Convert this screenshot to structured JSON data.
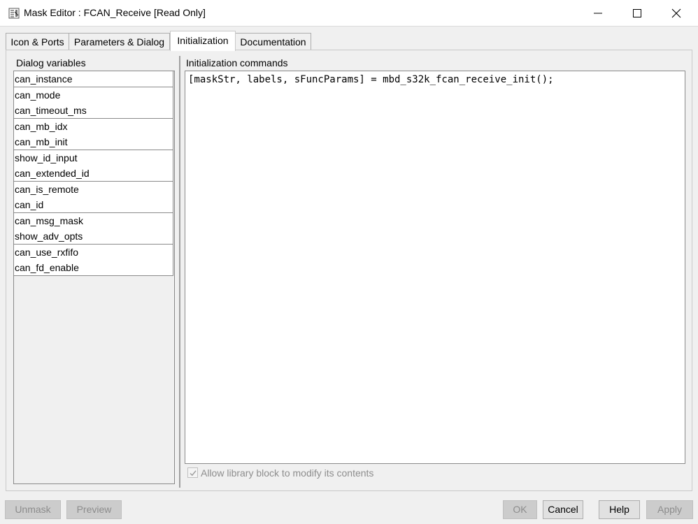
{
  "window": {
    "title": "Mask Editor : FCAN_Receive [Read Only]",
    "app_icon": "mask-editor-icon",
    "controls": [
      "minimize-icon",
      "maximize-icon",
      "close-icon"
    ]
  },
  "tabs": [
    {
      "label": "Icon & Ports",
      "active": false
    },
    {
      "label": "Parameters & Dialog",
      "active": false
    },
    {
      "label": "Initialization",
      "active": true
    },
    {
      "label": "Documentation",
      "active": false
    }
  ],
  "dialog_variables": {
    "header": "Dialog variables",
    "items": [
      "can_instance",
      "can_mode",
      "can_timeout_ms",
      "can_mb_idx",
      "can_mb_init",
      "show_id_input",
      "can_extended_id",
      "can_is_remote",
      "can_id",
      "can_msg_mask",
      "show_adv_opts",
      "can_use_rxfifo",
      "can_fd_enable"
    ]
  },
  "initialization": {
    "header": "Initialization commands",
    "code": "[maskStr, labels, sFuncParams] = mbd_s32k_fcan_receive_init();"
  },
  "allow_modify": {
    "label": "Allow library block to modify its contents",
    "checked": true,
    "enabled": false
  },
  "buttons": {
    "unmask": "Unmask",
    "preview": "Preview",
    "ok": "OK",
    "cancel": "Cancel",
    "help": "Help",
    "apply": "Apply"
  }
}
